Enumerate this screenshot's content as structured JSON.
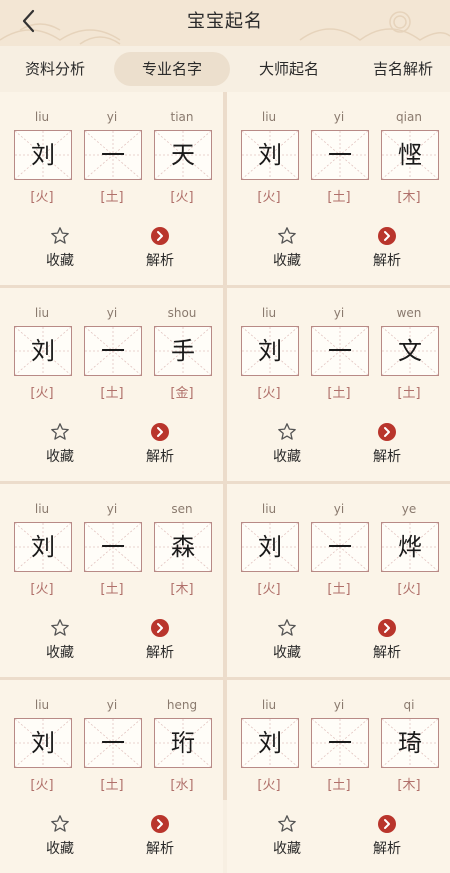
{
  "header": {
    "title": "宝宝起名",
    "back_icon": "chevron-left-icon"
  },
  "tabs": [
    {
      "label": "资料分析",
      "active": false
    },
    {
      "label": "专业名字",
      "active": true
    },
    {
      "label": "大师起名",
      "active": false
    },
    {
      "label": "吉名解析",
      "active": false
    }
  ],
  "actions": {
    "favorite_label": "收藏",
    "analyze_label": "解析"
  },
  "colors": {
    "accent": "#b9352c",
    "element_text": "#b0706a",
    "box_border": "#b88a86"
  },
  "names": [
    {
      "chars": [
        {
          "pinyin": "liu",
          "char": "刘",
          "element": "[火]"
        },
        {
          "pinyin": "yi",
          "char": "一",
          "element": "[土]"
        },
        {
          "pinyin": "tian",
          "char": "天",
          "element": "[火]"
        }
      ]
    },
    {
      "chars": [
        {
          "pinyin": "liu",
          "char": "刘",
          "element": "[火]"
        },
        {
          "pinyin": "yi",
          "char": "一",
          "element": "[土]"
        },
        {
          "pinyin": "qian",
          "char": "悭",
          "element": "[木]"
        }
      ]
    },
    {
      "chars": [
        {
          "pinyin": "liu",
          "char": "刘",
          "element": "[火]"
        },
        {
          "pinyin": "yi",
          "char": "一",
          "element": "[土]"
        },
        {
          "pinyin": "shou",
          "char": "手",
          "element": "[金]"
        }
      ]
    },
    {
      "chars": [
        {
          "pinyin": "liu",
          "char": "刘",
          "element": "[火]"
        },
        {
          "pinyin": "yi",
          "char": "一",
          "element": "[土]"
        },
        {
          "pinyin": "wen",
          "char": "文",
          "element": "[土]"
        }
      ]
    },
    {
      "chars": [
        {
          "pinyin": "liu",
          "char": "刘",
          "element": "[火]"
        },
        {
          "pinyin": "yi",
          "char": "一",
          "element": "[土]"
        },
        {
          "pinyin": "sen",
          "char": "森",
          "element": "[木]"
        }
      ]
    },
    {
      "chars": [
        {
          "pinyin": "liu",
          "char": "刘",
          "element": "[火]"
        },
        {
          "pinyin": "yi",
          "char": "一",
          "element": "[土]"
        },
        {
          "pinyin": "ye",
          "char": "烨",
          "element": "[火]"
        }
      ]
    },
    {
      "chars": [
        {
          "pinyin": "liu",
          "char": "刘",
          "element": "[火]"
        },
        {
          "pinyin": "yi",
          "char": "一",
          "element": "[土]"
        },
        {
          "pinyin": "heng",
          "char": "珩",
          "element": "[水]"
        }
      ]
    },
    {
      "chars": [
        {
          "pinyin": "liu",
          "char": "刘",
          "element": "[火]"
        },
        {
          "pinyin": "yi",
          "char": "一",
          "element": "[土]"
        },
        {
          "pinyin": "qi",
          "char": "琦",
          "element": "[木]"
        }
      ]
    }
  ]
}
